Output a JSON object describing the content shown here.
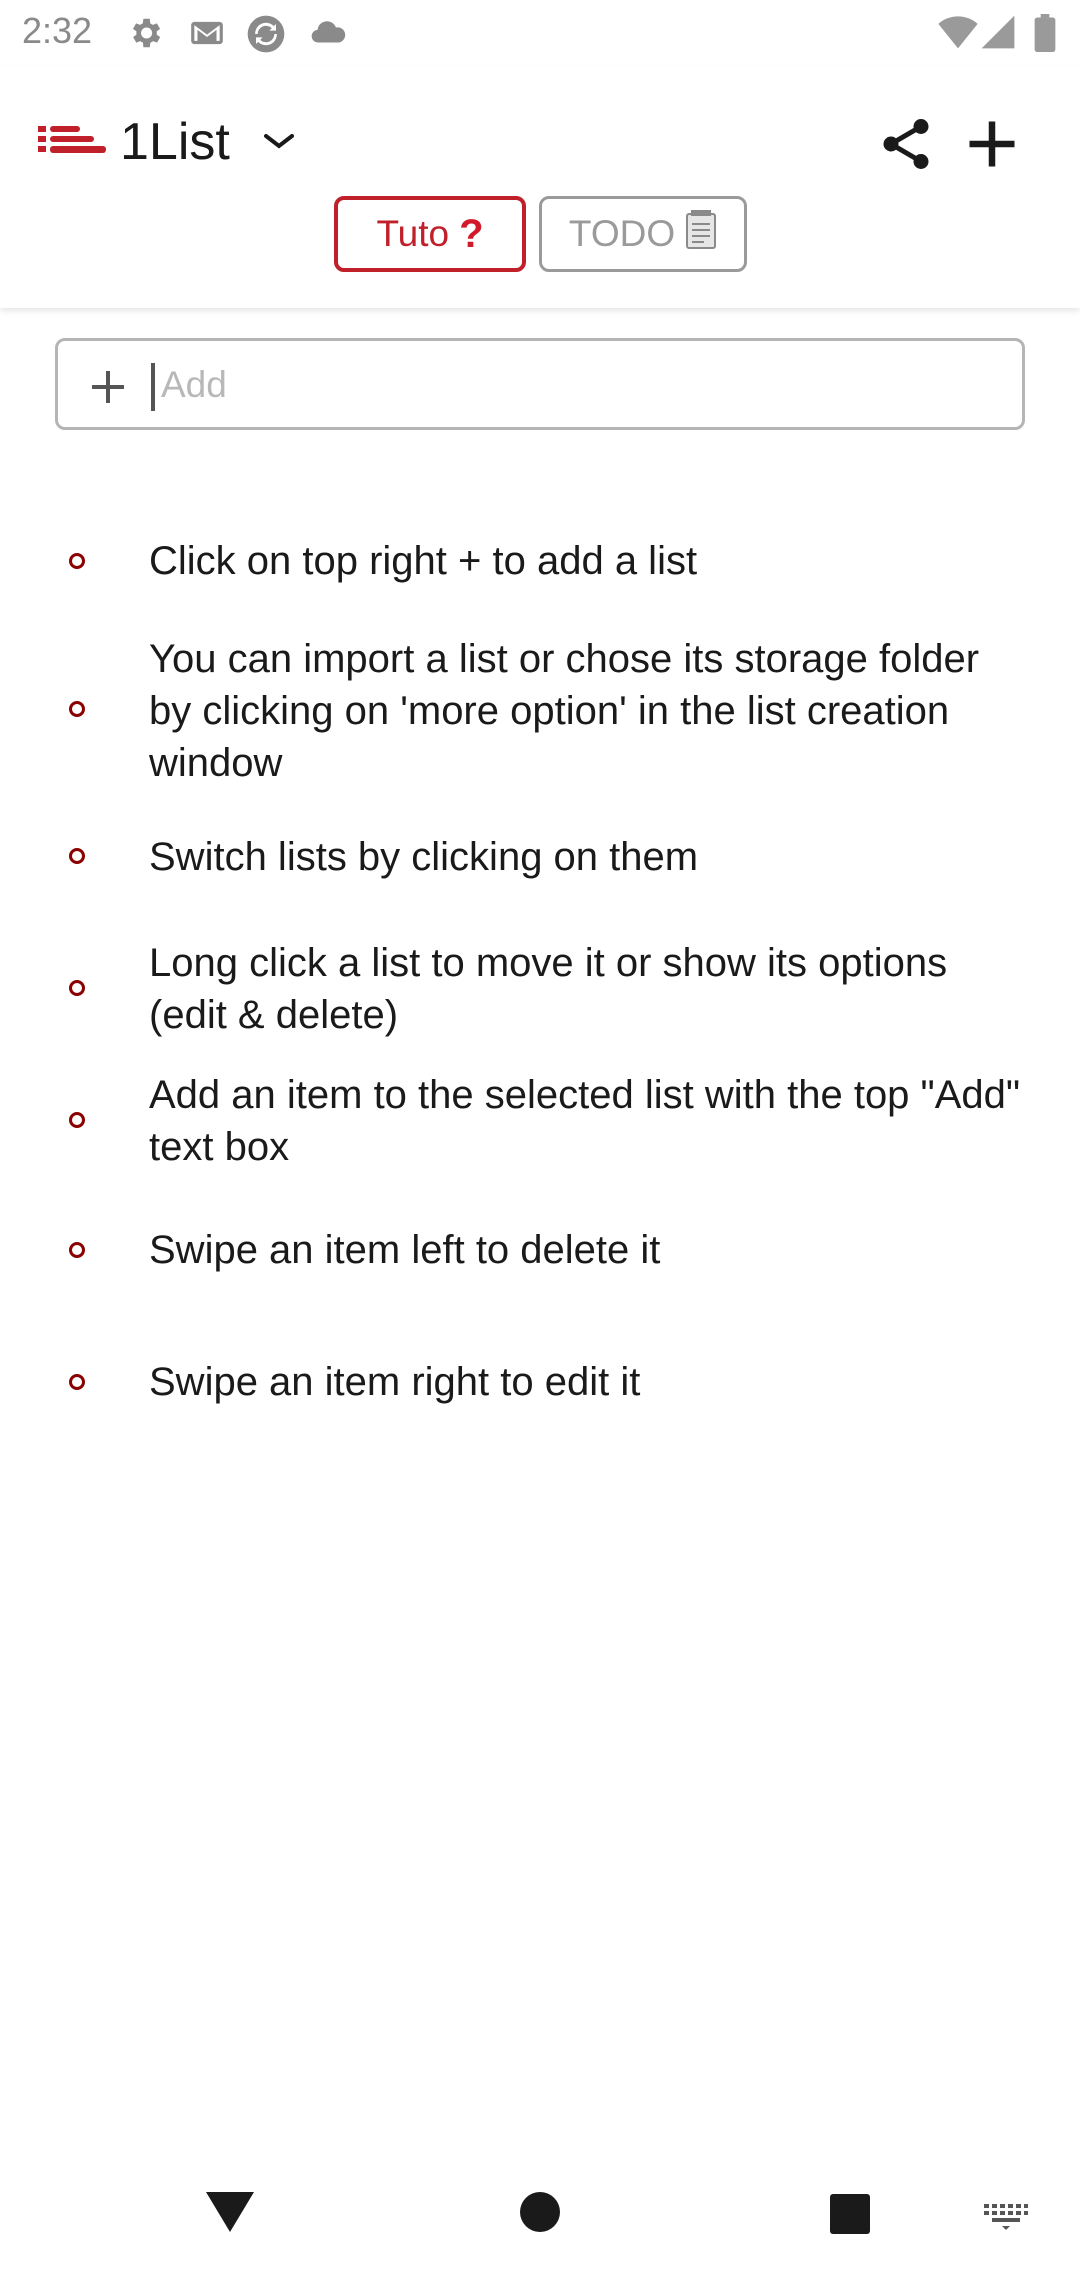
{
  "status_bar": {
    "time": "2:32",
    "left_icons": [
      "settings-icon",
      "gmail-icon",
      "sync-icon",
      "cloud-icon"
    ],
    "right_icons": [
      "wifi-icon",
      "signal-icon",
      "battery-icon"
    ]
  },
  "header": {
    "logo_icon": "list-logo-icon",
    "title": "1List",
    "dropdown_icon": "chevron-down-icon",
    "share_icon": "share-icon",
    "add_list_icon": "plus-icon",
    "accent_color": "#c0202a"
  },
  "tabs": [
    {
      "label": "Tuto",
      "emoji": "❓",
      "selected": true
    },
    {
      "label": "TODO",
      "emoji": "notepad-icon",
      "selected": false
    }
  ],
  "add_field": {
    "placeholder": "Add",
    "value": "",
    "icon": "plus-icon"
  },
  "items": [
    {
      "text": "Click on top right + to add a list"
    },
    {
      "text": "You can import a list or chose its storage folder by clicking on 'more option' in the list creation window"
    },
    {
      "text": "Switch lists by clicking on them"
    },
    {
      "text": "Long click a list to move it or show its options (edit & delete)"
    },
    {
      "text": "Add an item to the selected list with the top \"Add\" text box"
    },
    {
      "text": "Swipe an item left to delete it"
    },
    {
      "text": "Swipe an item right to edit it"
    }
  ],
  "nav_bar": {
    "back_icon": "back-triangle-icon",
    "home_icon": "home-circle-icon",
    "recents_icon": "recents-square-icon",
    "keyboard_icon": "keyboard-icon"
  }
}
